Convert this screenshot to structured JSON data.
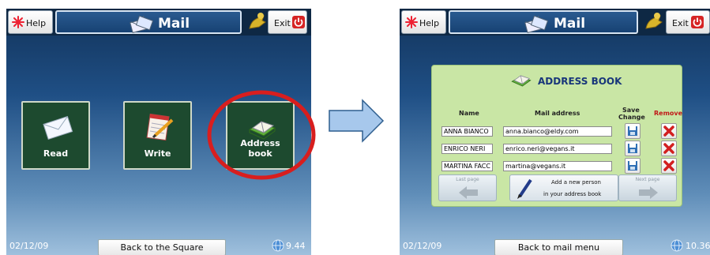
{
  "colors": {
    "topbar": "#0e2844",
    "tile": "#1d4a2f",
    "panel": "#c9e6a5",
    "highlight_circle": "#d81e1e",
    "arrow_fill": "#a7c8ec",
    "arrow_stroke": "#2f5f8f"
  },
  "screen1": {
    "help_label": "Help",
    "title": "Mail",
    "exit_label": "Exit",
    "tiles": [
      {
        "label": "Read",
        "icon": "envelope-icon"
      },
      {
        "label": "Write",
        "icon": "notepad-pen-icon"
      },
      {
        "label": "Address book",
        "icon": "address-book-icon"
      }
    ],
    "date": "02/12/09",
    "back_label": "Back to the Square",
    "time": "9.44"
  },
  "screen2": {
    "help_label": "Help",
    "title": "Mail",
    "exit_label": "Exit",
    "panel_title": "ADDRESS BOOK",
    "col_name": "Name",
    "col_mail": "Mail address",
    "col_save_1": "Save",
    "col_save_2": "Change",
    "col_remove": "Remove",
    "contacts": [
      {
        "name": "ANNA BIANCO",
        "email": "anna.bianco@eldy.com"
      },
      {
        "name": "ENRICO NERI",
        "email": "enrico.neri@vegans.it"
      },
      {
        "name": "MARTINA FACC",
        "email": "martina@vegans.it"
      }
    ],
    "last_page": "Last page",
    "add_line1": "Add a new person",
    "add_line2": "in your address book",
    "next_page": "Next page",
    "date": "02/12/09",
    "back_label": "Back to mail menu",
    "time": "10.36"
  }
}
